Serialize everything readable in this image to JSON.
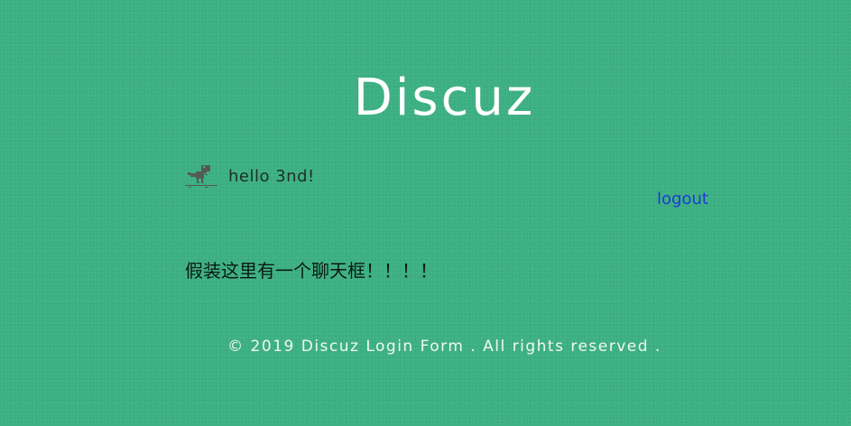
{
  "header": {
    "title": "Discuz"
  },
  "user": {
    "avatar_icon": "dinosaur-icon",
    "greeting": "hello 3nd!"
  },
  "actions": {
    "logout_label": "logout"
  },
  "content": {
    "chat_placeholder_text": "假装这里有一个聊天框！！！！"
  },
  "footer": {
    "copyright": "© 2019 Discuz Login Form . All rights reserved ."
  },
  "colors": {
    "background": "#3db083",
    "title_text": "#ffffff",
    "link": "#1d3bd6"
  }
}
